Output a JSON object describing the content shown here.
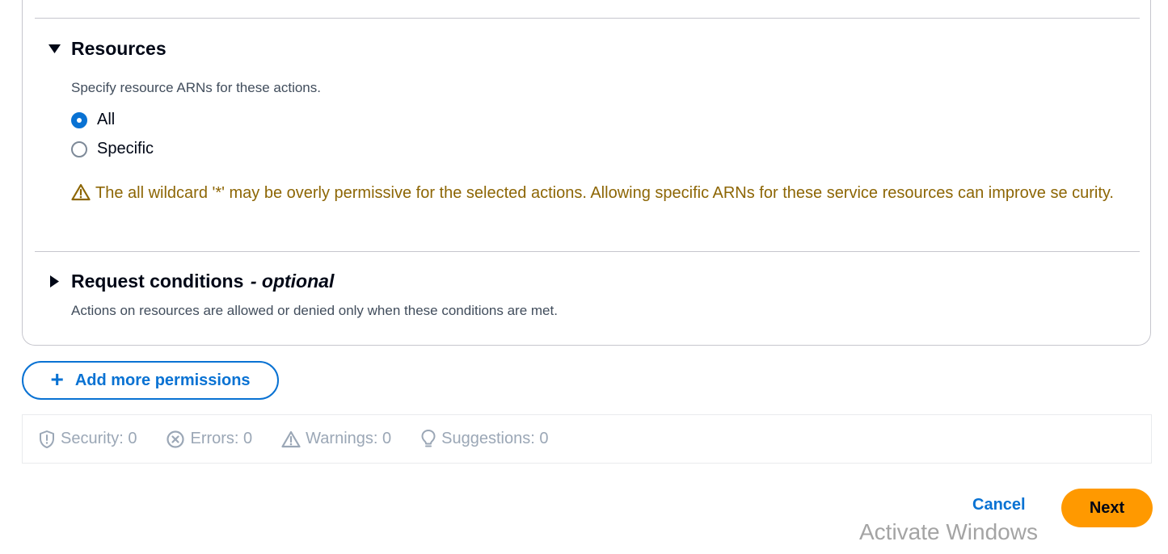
{
  "resources": {
    "title": "Resources",
    "description": "Specify resource ARNs for these actions.",
    "options": [
      {
        "label": "All",
        "checked": true
      },
      {
        "label": "Specific",
        "checked": false
      }
    ],
    "warning_text": "The all wildcard '*' may be overly permissive for the selected actions. Allowing specific ARNs for these service resources can improve se curity.",
    "warning_color": "#8d6605"
  },
  "request_conditions": {
    "title": "Request conditions",
    "optional_label": "- optional",
    "description": "Actions on resources are allowed or denied only when these conditions are met."
  },
  "add_permissions_label": "Add more permissions",
  "status": {
    "security": "Security: 0",
    "errors": "Errors: 0",
    "warnings": "Warnings: 0",
    "suggestions": "Suggestions: 0"
  },
  "footer": {
    "cancel_label": "Cancel",
    "next_label": "Next",
    "primary_color": "#ff9900",
    "link_color": "#0972d3"
  },
  "watermark": "Activate Windows"
}
